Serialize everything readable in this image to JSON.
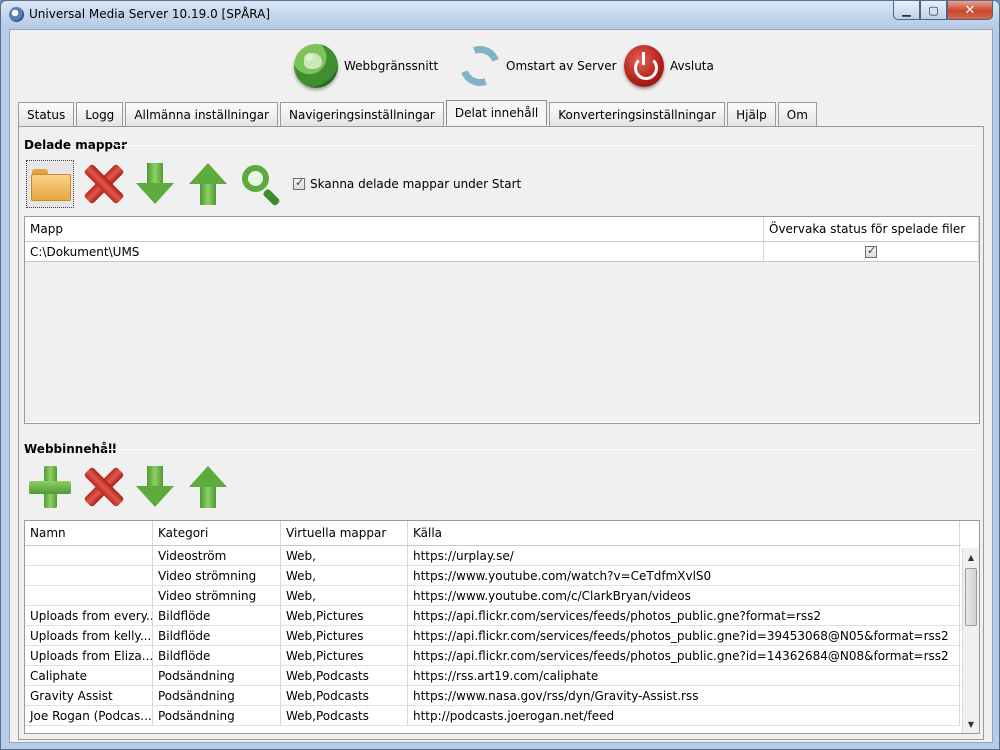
{
  "window": {
    "title": "Universal Media Server 10.19.0  [SPÅRA]",
    "min_glyph": "▁",
    "max_glyph": "▢",
    "close_glyph": "✕"
  },
  "toolbar": {
    "web_label": "Webbgränssnitt",
    "restart_label": "Omstart av Server",
    "quit_label": "Avsluta"
  },
  "tabs": [
    {
      "label": "Status"
    },
    {
      "label": "Logg"
    },
    {
      "label": "Allmänna inställningar"
    },
    {
      "label": "Navigeringsinställningar"
    },
    {
      "label": "Delat innehåll"
    },
    {
      "label": "Konverteringsinställningar"
    },
    {
      "label": "Hjälp"
    },
    {
      "label": "Om"
    }
  ],
  "shared": {
    "title": "Delade mappar",
    "scan_label": "Skanna delade mappar under Start",
    "scan_checked": true,
    "columns": [
      "Mapp",
      "Övervaka status för spelade filer"
    ],
    "rows": [
      {
        "folder": "C:\\Dokument\\UMS",
        "monitor": true
      }
    ]
  },
  "web": {
    "title": "Webbinnehåll",
    "columns": [
      "Namn",
      "Kategori",
      "Virtuella mappar",
      "Källa"
    ],
    "rows": [
      [
        "",
        "Videoström",
        "Web,",
        "https://urplay.se/"
      ],
      [
        "",
        "Video strömning",
        "Web,",
        "https://www.youtube.com/watch?v=CeTdfmXvlS0"
      ],
      [
        "",
        "Video strömning",
        "Web,",
        "https://www.youtube.com/c/ClarkBryan/videos"
      ],
      [
        "Uploads from every...",
        "Bildflöde",
        "Web,Pictures",
        "https://api.flickr.com/services/feeds/photos_public.gne?format=rss2"
      ],
      [
        "Uploads from kelly....",
        "Bildflöde",
        "Web,Pictures",
        "https://api.flickr.com/services/feeds/photos_public.gne?id=39453068@N05&format=rss2"
      ],
      [
        "Uploads from Eliza...",
        "Bildflöde",
        "Web,Pictures",
        "https://api.flickr.com/services/feeds/photos_public.gne?id=14362684@N08&format=rss2"
      ],
      [
        "Caliphate",
        "Podsändning",
        "Web,Podcasts",
        "https://rss.art19.com/caliphate"
      ],
      [
        "Gravity Assist",
        "Podsändning",
        "Web,Podcasts",
        "https://www.nasa.gov/rss/dyn/Gravity-Assist.rss"
      ],
      [
        "Joe Rogan (Podcas...",
        "Podsändning",
        "Web,Podcasts",
        "http://podcasts.joerogan.net/feed"
      ]
    ]
  }
}
